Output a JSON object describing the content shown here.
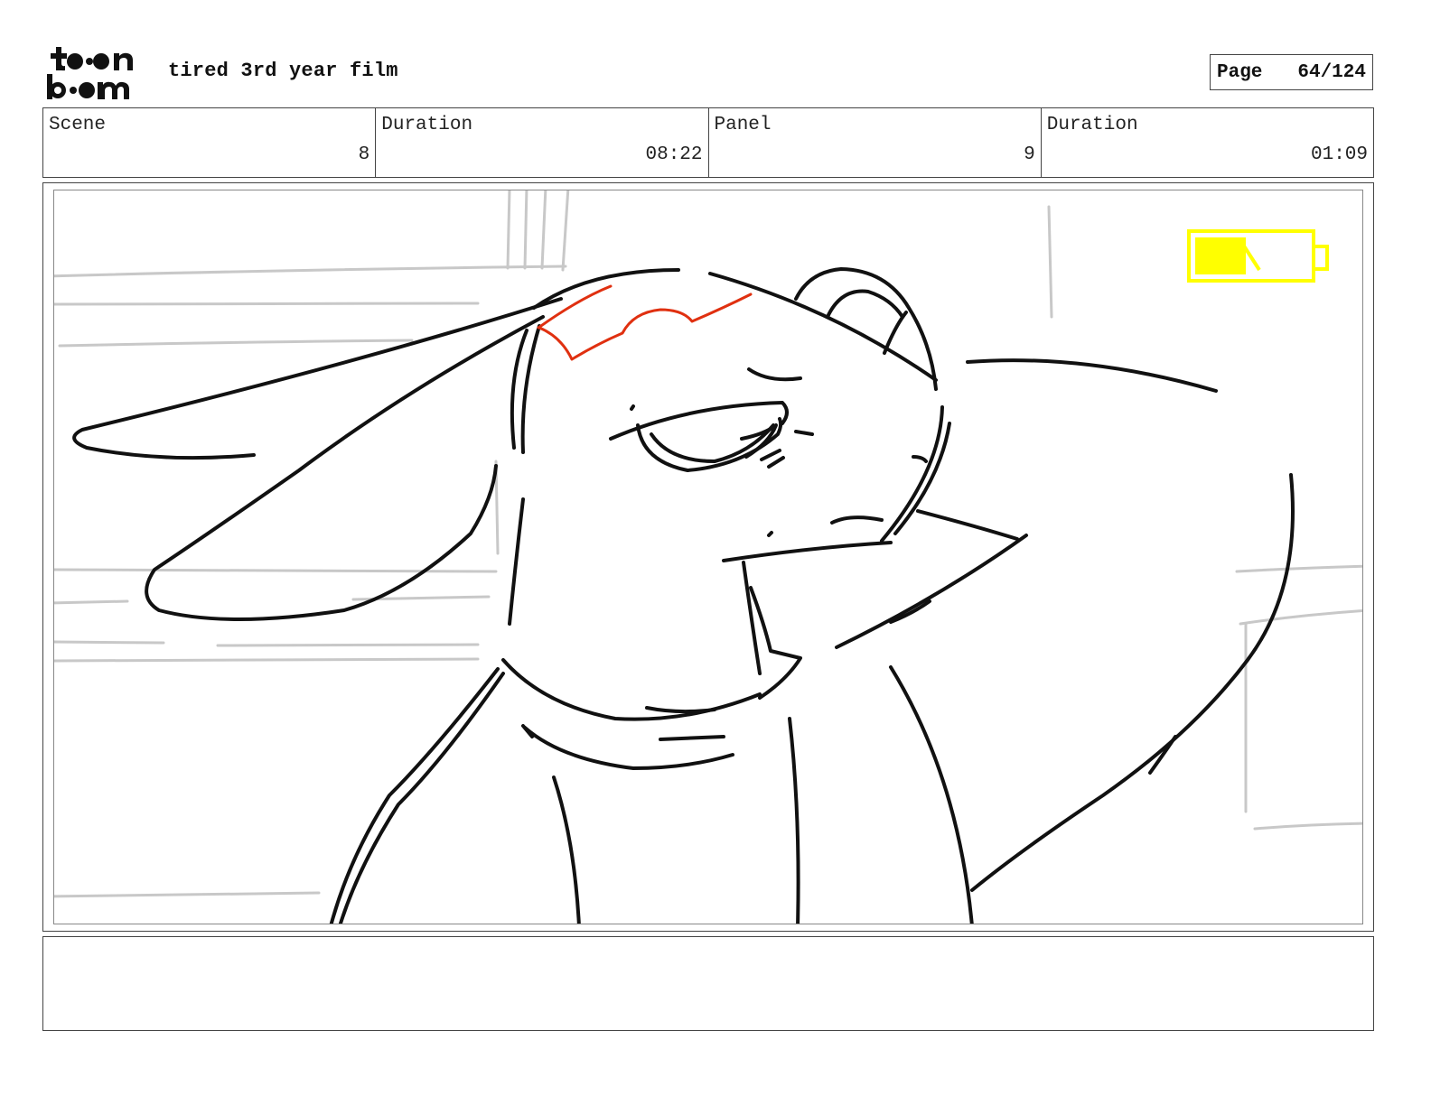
{
  "header": {
    "logo_text": "toon boom",
    "project_title": "tired 3rd year film",
    "page_label": "Page",
    "page_number": "64/124"
  },
  "info": [
    {
      "label": "Scene",
      "value": "8"
    },
    {
      "label": "Duration",
      "value": "08:22"
    },
    {
      "label": "Panel",
      "value": "9"
    },
    {
      "label": "Duration",
      "value": "01:09"
    }
  ],
  "panel": {
    "battery_level": 0.45,
    "colors": {
      "line": "#111111",
      "background_lines": "#c8c8c8",
      "brow_mark": "#e03010",
      "battery": "#ffff00"
    }
  },
  "notes": {
    "text": ""
  }
}
